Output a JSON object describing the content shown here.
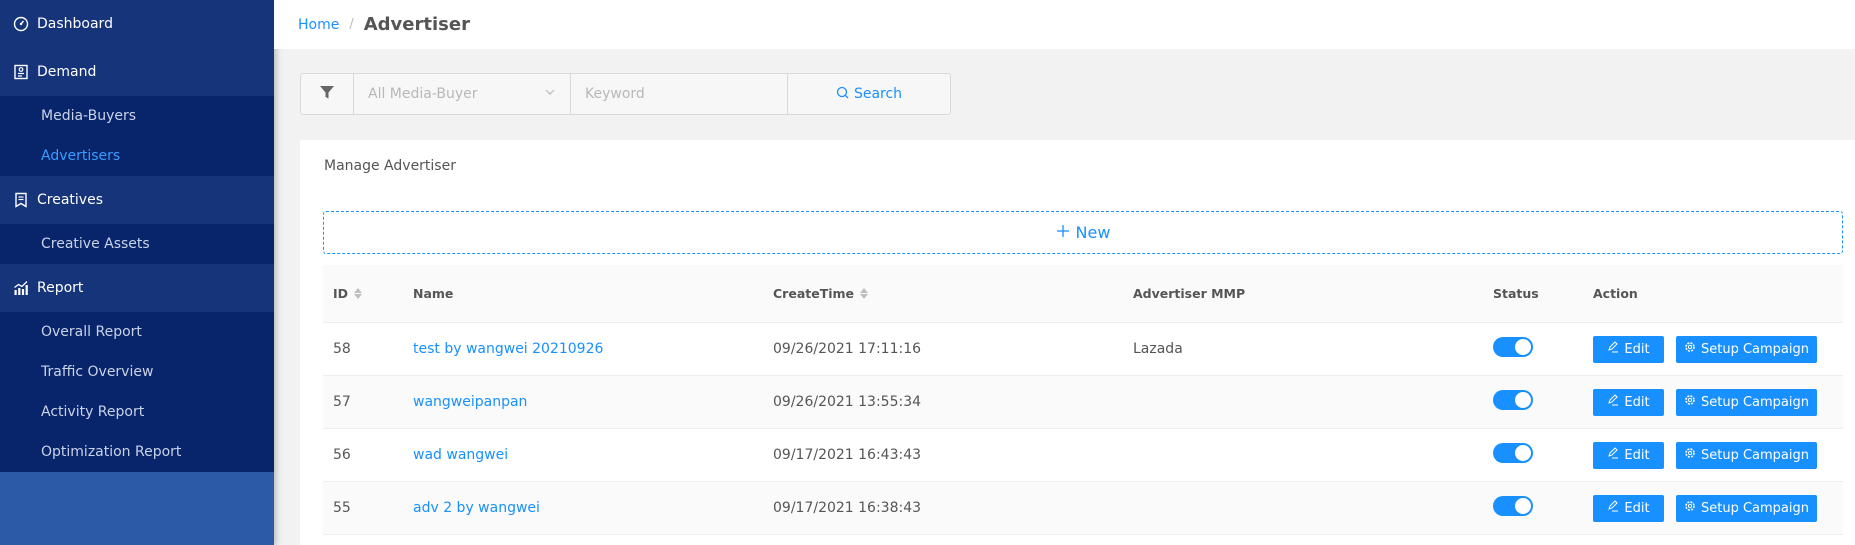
{
  "sidebar": {
    "groups": [
      {
        "label": "Dashboard",
        "icon": "dashboard-icon",
        "items": []
      },
      {
        "label": "Demand",
        "icon": "demand-icon",
        "items": [
          {
            "label": "Media-Buyers",
            "active": false
          },
          {
            "label": "Advertisers",
            "active": true
          }
        ]
      },
      {
        "label": "Creatives",
        "icon": "bookmark-icon",
        "items": [
          {
            "label": "Creative Assets",
            "active": false
          }
        ]
      },
      {
        "label": "Report",
        "icon": "chart-icon",
        "items": [
          {
            "label": "Overall Report",
            "active": false
          },
          {
            "label": "Traffic Overview",
            "active": false
          },
          {
            "label": "Activity Report",
            "active": false
          },
          {
            "label": "Optimization Report",
            "active": false
          }
        ]
      }
    ]
  },
  "breadcrumb": {
    "home": "Home",
    "separator": "/",
    "current": "Advertiser"
  },
  "filter": {
    "media_buyer_placeholder": "All Media-Buyer",
    "keyword_placeholder": "Keyword",
    "keyword_value": "",
    "search_label": "Search"
  },
  "card": {
    "title": "Manage Advertiser",
    "new_label": "New"
  },
  "table": {
    "columns": {
      "id": "ID",
      "name": "Name",
      "create_time": "CreateTime",
      "mmp": "Advertiser MMP",
      "status": "Status",
      "action": "Action"
    },
    "edit_label": "Edit",
    "setup_label": "Setup Campaign",
    "rows": [
      {
        "id": "58",
        "name": "test by wangwei 20210926",
        "create_time": "09/26/2021 17:11:16",
        "mmp": "Lazada",
        "status": true
      },
      {
        "id": "57",
        "name": "wangweipanpan",
        "create_time": "09/26/2021 13:55:34",
        "mmp": "",
        "status": true
      },
      {
        "id": "56",
        "name": "wad wangwei",
        "create_time": "09/17/2021 16:43:43",
        "mmp": "",
        "status": true
      },
      {
        "id": "55",
        "name": "adv 2 by wangwei",
        "create_time": "09/17/2021 16:38:43",
        "mmp": "",
        "status": true
      }
    ]
  },
  "colors": {
    "accent": "#1890ff",
    "sidebar_group": "#16347a",
    "sidebar_sub": "#08246a",
    "sidebar_bg": "#2d5aa6"
  }
}
